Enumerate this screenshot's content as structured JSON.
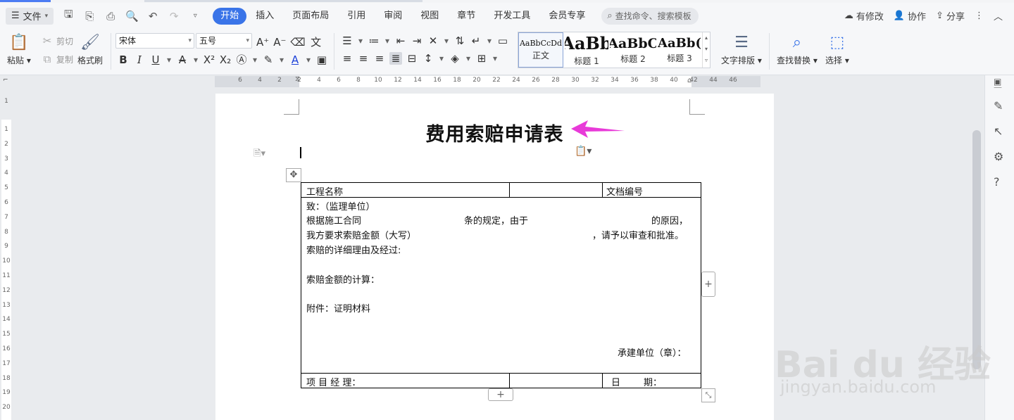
{
  "menubar": {
    "file_label": "文件",
    "tabs": [
      "开始",
      "插入",
      "页面布局",
      "引用",
      "审阅",
      "视图",
      "章节",
      "开发工具",
      "会员专享"
    ],
    "search_placeholder": "查找命令、搜索模板",
    "modified_label": "有修改",
    "collab_label": "协作",
    "share_label": "分享"
  },
  "ribbon": {
    "paste_label": "粘贴",
    "cut_label": "剪切",
    "copy_label": "复制",
    "format_painter_label": "格式刷",
    "font_name": "宋体",
    "font_size": "五号",
    "styles": [
      {
        "sample": "AaBbCcDd",
        "label": "正文"
      },
      {
        "sample": "AaBb",
        "label": "标题 1"
      },
      {
        "sample": "AaBbC",
        "label": "标题 2"
      },
      {
        "sample": "AaBb(",
        "label": "标题 3"
      }
    ],
    "text_layout_label": "文字排版",
    "find_replace_label": "查找替换",
    "select_label": "选择"
  },
  "ruler": {
    "h_ticks": [
      "6",
      "4",
      "2",
      "2",
      "4",
      "6",
      "8",
      "10",
      "12",
      "14",
      "16",
      "18",
      "20",
      "22",
      "24",
      "26",
      "28",
      "30",
      "32",
      "34",
      "36",
      "38",
      "40",
      "42",
      "44",
      "46"
    ],
    "v_ticks": [
      "1",
      "1",
      "2",
      "3",
      "4",
      "5",
      "6",
      "7",
      "8",
      "9",
      "10",
      "11",
      "12",
      "13",
      "14",
      "15",
      "16",
      "17",
      "18",
      "19",
      "20"
    ]
  },
  "document": {
    "title": "费用索赔申请表",
    "table": {
      "project_name_label": "工程名称",
      "doc_number_label": "文档编号",
      "to_line": "致：（监理单位）",
      "line1_a": "根据施工合同",
      "line1_b": "条的规定，由于",
      "line1_c": "的原因，",
      "line2_a": "我方要求索赔金额（大写）",
      "line2_b": "，请予以审查和批准。",
      "detail_label": "索赔的详细理由及经过:",
      "calc_label": "索赔金额的计算：",
      "attachment_label": "附件：证明材料",
      "contractor_label": "承建单位（章）：",
      "pm_label": "项 目 经 理：",
      "date_label": "日        期："
    }
  },
  "watermark": {
    "brand": "Bai du 经验",
    "url": "jingyan.baidu.com"
  },
  "colors": {
    "accent": "#3a74e8",
    "arrow": "#e83ad8"
  }
}
